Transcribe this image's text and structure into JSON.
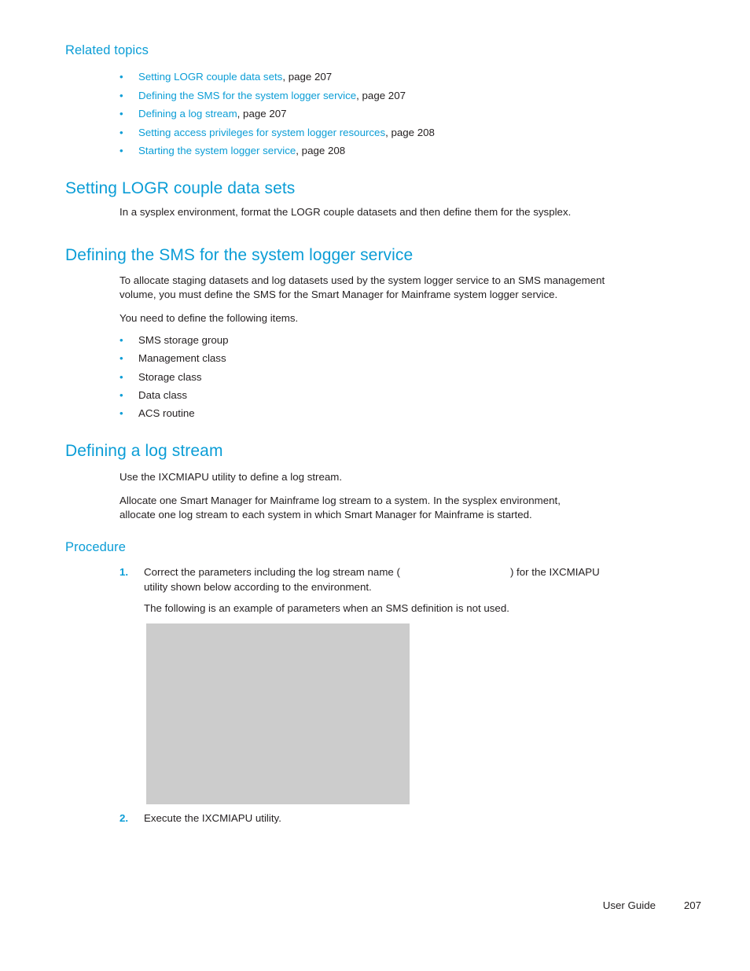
{
  "page": {
    "related_topics_heading": "Related topics",
    "related_topics": [
      {
        "link": "Setting LOGR couple data sets",
        "page_ref": ", page 207"
      },
      {
        "link": "Defining the SMS for the system logger service",
        "page_ref": ", page 207"
      },
      {
        "link": "Defining a log stream",
        "page_ref": ", page 207"
      },
      {
        "link": "Setting access privileges for system logger resources",
        "page_ref": ", page 208"
      },
      {
        "link": "Starting the system logger service",
        "page_ref": ", page 208"
      }
    ],
    "section_logr": {
      "heading": "Setting LOGR couple data sets",
      "paragraph": "In a sysplex environment, format the LOGR couple datasets and then define them for the sysplex."
    },
    "section_sms": {
      "heading": "Defining the SMS for the system logger service",
      "paragraph1_line1": "To allocate staging datasets and log datasets used by the system logger service to an SMS management",
      "paragraph1_line2": "volume, you must define the SMS for the Smart Manager for Mainframe system logger service.",
      "paragraph2": "You need to define the following items.",
      "items": [
        "SMS storage group",
        "Management class",
        "Storage class",
        "Data class",
        "ACS routine"
      ]
    },
    "section_logstream": {
      "heading": "Defining a log stream",
      "paragraph1": "Use the IXCMIAPU utility to define a log stream.",
      "paragraph2_line1": "Allocate one Smart Manager for Mainframe log stream to a system. In the sysplex environment,",
      "paragraph2_line2": "allocate one log stream to each system in which Smart Manager for Mainframe is started.",
      "procedure_heading": "Procedure",
      "steps": [
        {
          "number": "1.",
          "line1_before": "Correct the parameters including the log stream name (",
          "line1_after": ") for the IXCMIAPU",
          "line2": "utility shown below according to the environment.",
          "note": "The following is an example of parameters when an SMS definition is not used."
        },
        {
          "number": "2.",
          "text": "Execute the IXCMIAPU utility."
        }
      ]
    },
    "bullet_glyph": "•",
    "footer": {
      "label": "User Guide",
      "page_number": "207"
    },
    "colors": {
      "accent": "#0b9dd6",
      "body_text": "#231f20",
      "figure_placeholder": "#cccccc"
    }
  }
}
